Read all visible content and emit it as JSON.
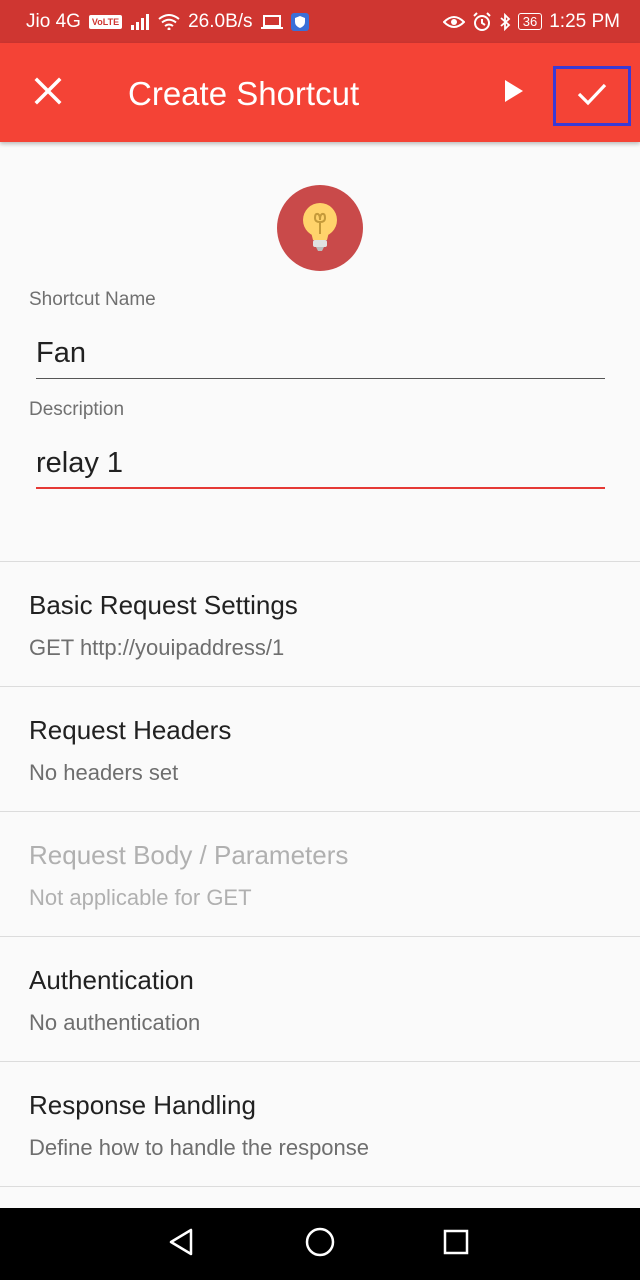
{
  "status_bar": {
    "carrier": "Jio 4G",
    "volte": "VoLTE",
    "speed": "26.0B/s",
    "battery": "36",
    "time": "1:25 PM"
  },
  "app_bar": {
    "title": "Create Shortcut"
  },
  "form": {
    "name_label": "Shortcut Name",
    "name_value": "Fan",
    "description_label": "Description",
    "description_value": "relay 1"
  },
  "sections": [
    {
      "title": "Basic Request Settings",
      "subtitle": "GET http://youipaddress/1",
      "enabled": true
    },
    {
      "title": "Request Headers",
      "subtitle": "No headers set",
      "enabled": true
    },
    {
      "title": "Request Body / Parameters",
      "subtitle": "Not applicable for GET",
      "enabled": false
    },
    {
      "title": "Authentication",
      "subtitle": "No authentication",
      "enabled": true
    },
    {
      "title": "Response Handling",
      "subtitle": "Define how to handle the response",
      "enabled": true
    }
  ],
  "colors": {
    "status_bar": "#cf3631",
    "app_bar": "#f44336",
    "accent_underline": "#e53935",
    "avatar": "#c94a4a",
    "highlight_border": "#3a3ad6"
  },
  "icons": {
    "close": "close-icon",
    "play": "play-icon",
    "confirm": "check-icon",
    "shortcut": "lightbulb-icon",
    "nav_back": "triangle-back-icon",
    "nav_home": "circle-home-icon",
    "nav_recents": "square-recents-icon"
  }
}
